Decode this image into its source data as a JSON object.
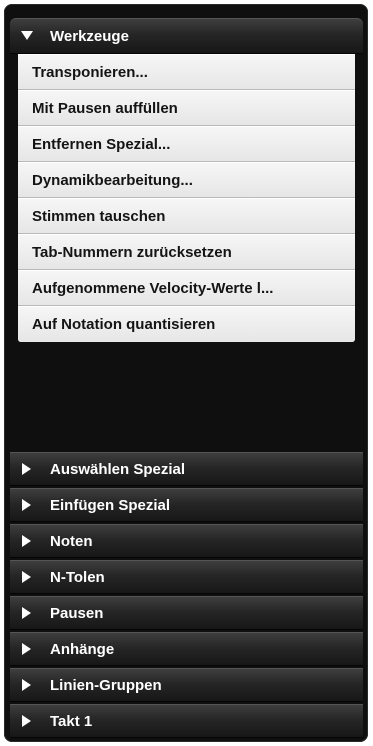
{
  "open_section": {
    "title": "Werkzeuge",
    "icon": "triangle-down-icon",
    "items": [
      "Transponieren...",
      "Mit Pausen auffüllen",
      "Entfernen Spezial...",
      "Dynamikbearbeitung...",
      "Stimmen tauschen",
      "Tab-Nummern zurücksetzen",
      "Aufgenommene Velocity-Werte l...",
      "Auf Notation quantisieren"
    ]
  },
  "collapsed_sections": [
    {
      "title": "Auswählen Spezial",
      "icon": "triangle-right-icon"
    },
    {
      "title": "Einfügen Spezial",
      "icon": "triangle-right-icon"
    },
    {
      "title": "Noten",
      "icon": "triangle-right-icon"
    },
    {
      "title": "N-Tolen",
      "icon": "triangle-right-icon"
    },
    {
      "title": "Pausen",
      "icon": "triangle-right-icon"
    },
    {
      "title": "Anhänge",
      "icon": "triangle-right-icon"
    },
    {
      "title": "Linien-Gruppen",
      "icon": "triangle-right-icon"
    },
    {
      "title": "Takt 1",
      "icon": "triangle-right-icon"
    }
  ],
  "colors": {
    "panel_background": "#0f0f0f",
    "header_text": "#ffffff",
    "item_background": "#efefef",
    "item_text": "#141414"
  }
}
